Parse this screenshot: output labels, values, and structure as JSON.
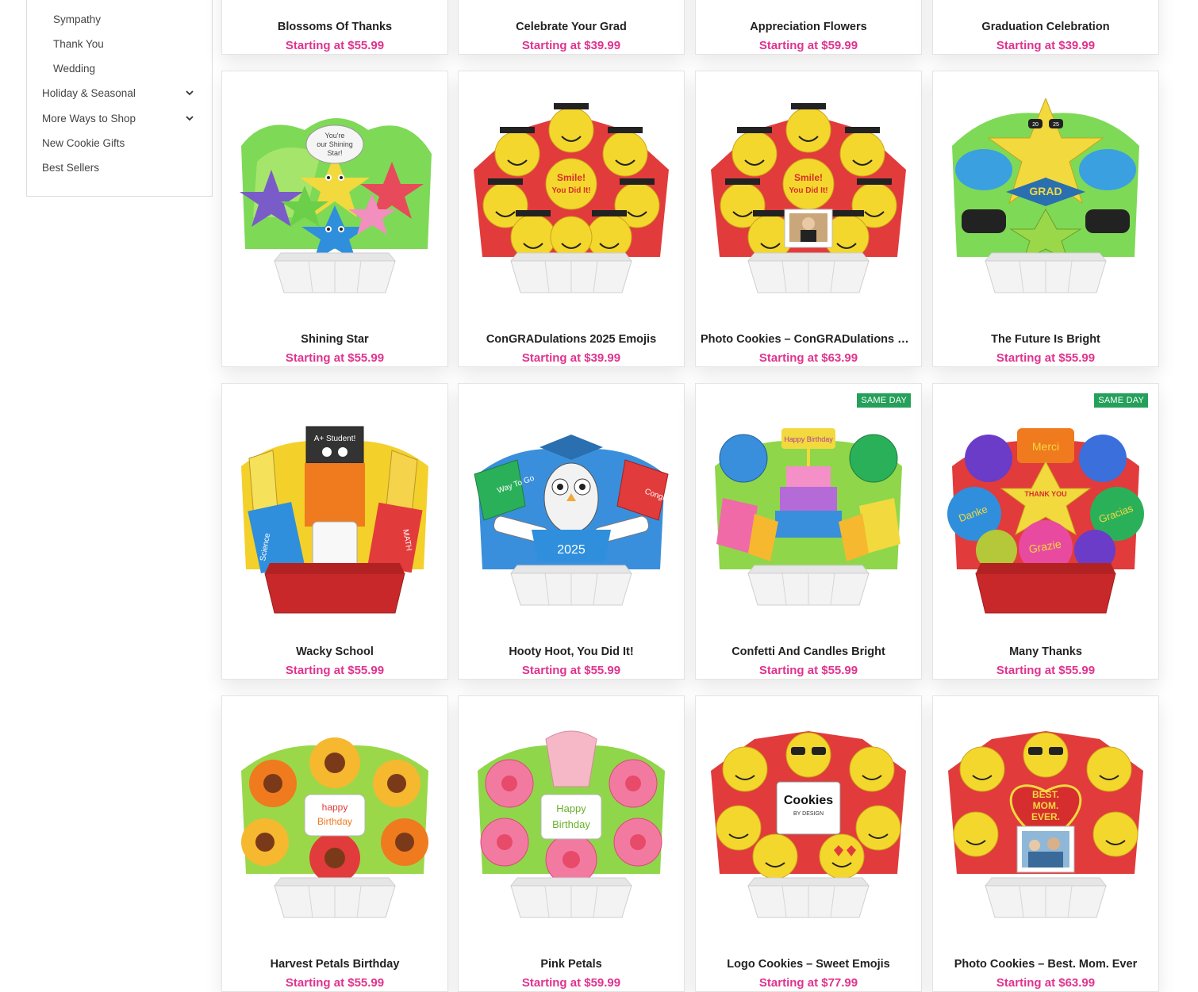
{
  "sidebar": {
    "items": [
      {
        "label": "Sympathy",
        "expandable": false
      },
      {
        "label": "Thank You",
        "expandable": false
      },
      {
        "label": "Wedding",
        "expandable": false
      },
      {
        "label": "Holiday & Seasonal",
        "expandable": true
      },
      {
        "label": "More Ways to Shop",
        "expandable": true
      },
      {
        "label": "New Cookie Gifts",
        "expandable": false
      },
      {
        "label": "Best Sellers",
        "expandable": false
      }
    ]
  },
  "products": [
    {
      "title": "Blossoms Of Thanks",
      "price": "Starting at $55.99"
    },
    {
      "title": "Celebrate Your Grad",
      "price": "Starting at $39.99"
    },
    {
      "title": "Appreciation Flowers",
      "price": "Starting at $59.99"
    },
    {
      "title": "Graduation Celebration",
      "price": "Starting at $39.99"
    },
    {
      "title": "Shining Star",
      "price": "Starting at $55.99",
      "image_text": [
        "You're",
        "our Shining",
        "Star!"
      ]
    },
    {
      "title": "ConGRADulations 2025 Emojis",
      "price": "Starting at $39.99",
      "image_text": [
        "Smile!",
        "You Did It!"
      ]
    },
    {
      "title": "Photo Cookies – ConGRADulations E…",
      "price": "Starting at $63.99",
      "image_text": [
        "Smile!",
        "You Did It!"
      ]
    },
    {
      "title": "The Future Is Bright",
      "price": "Starting at $55.99",
      "image_text": [
        "GRAD",
        "20",
        "25"
      ]
    },
    {
      "title": "Wacky School",
      "price": "Starting at $55.99",
      "image_text": [
        "A+ Student!",
        "Science",
        "MATH"
      ]
    },
    {
      "title": "Hooty Hoot, You Did It!",
      "price": "Starting at $55.99",
      "image_text": [
        "Way To Go",
        "Congrats",
        "2025"
      ]
    },
    {
      "title": "Confetti And Candles Bright",
      "price": "Starting at $55.99",
      "badge": "SAME DAY",
      "image_text": [
        "Happy Birthday"
      ]
    },
    {
      "title": "Many Thanks",
      "price": "Starting at $55.99",
      "badge": "SAME DAY",
      "image_text": [
        "Merci",
        "THANK YOU",
        "Danke",
        "Gracias",
        "Grazie"
      ]
    },
    {
      "title": "Harvest Petals Birthday",
      "price": "Starting at $55.99",
      "image_text": [
        "happy",
        "Birthday"
      ]
    },
    {
      "title": "Pink Petals",
      "price": "Starting at $59.99",
      "image_text": [
        "Happy",
        "Birthday"
      ]
    },
    {
      "title": "Logo Cookies – Sweet Emojis",
      "price": "Starting at $77.99",
      "image_text": [
        "Cookies",
        "BY DESIGN"
      ]
    },
    {
      "title": "Photo Cookies – Best. Mom. Ever",
      "price": "Starting at $63.99",
      "image_text": [
        "BEST.",
        "MOM.",
        "EVER."
      ]
    }
  ]
}
